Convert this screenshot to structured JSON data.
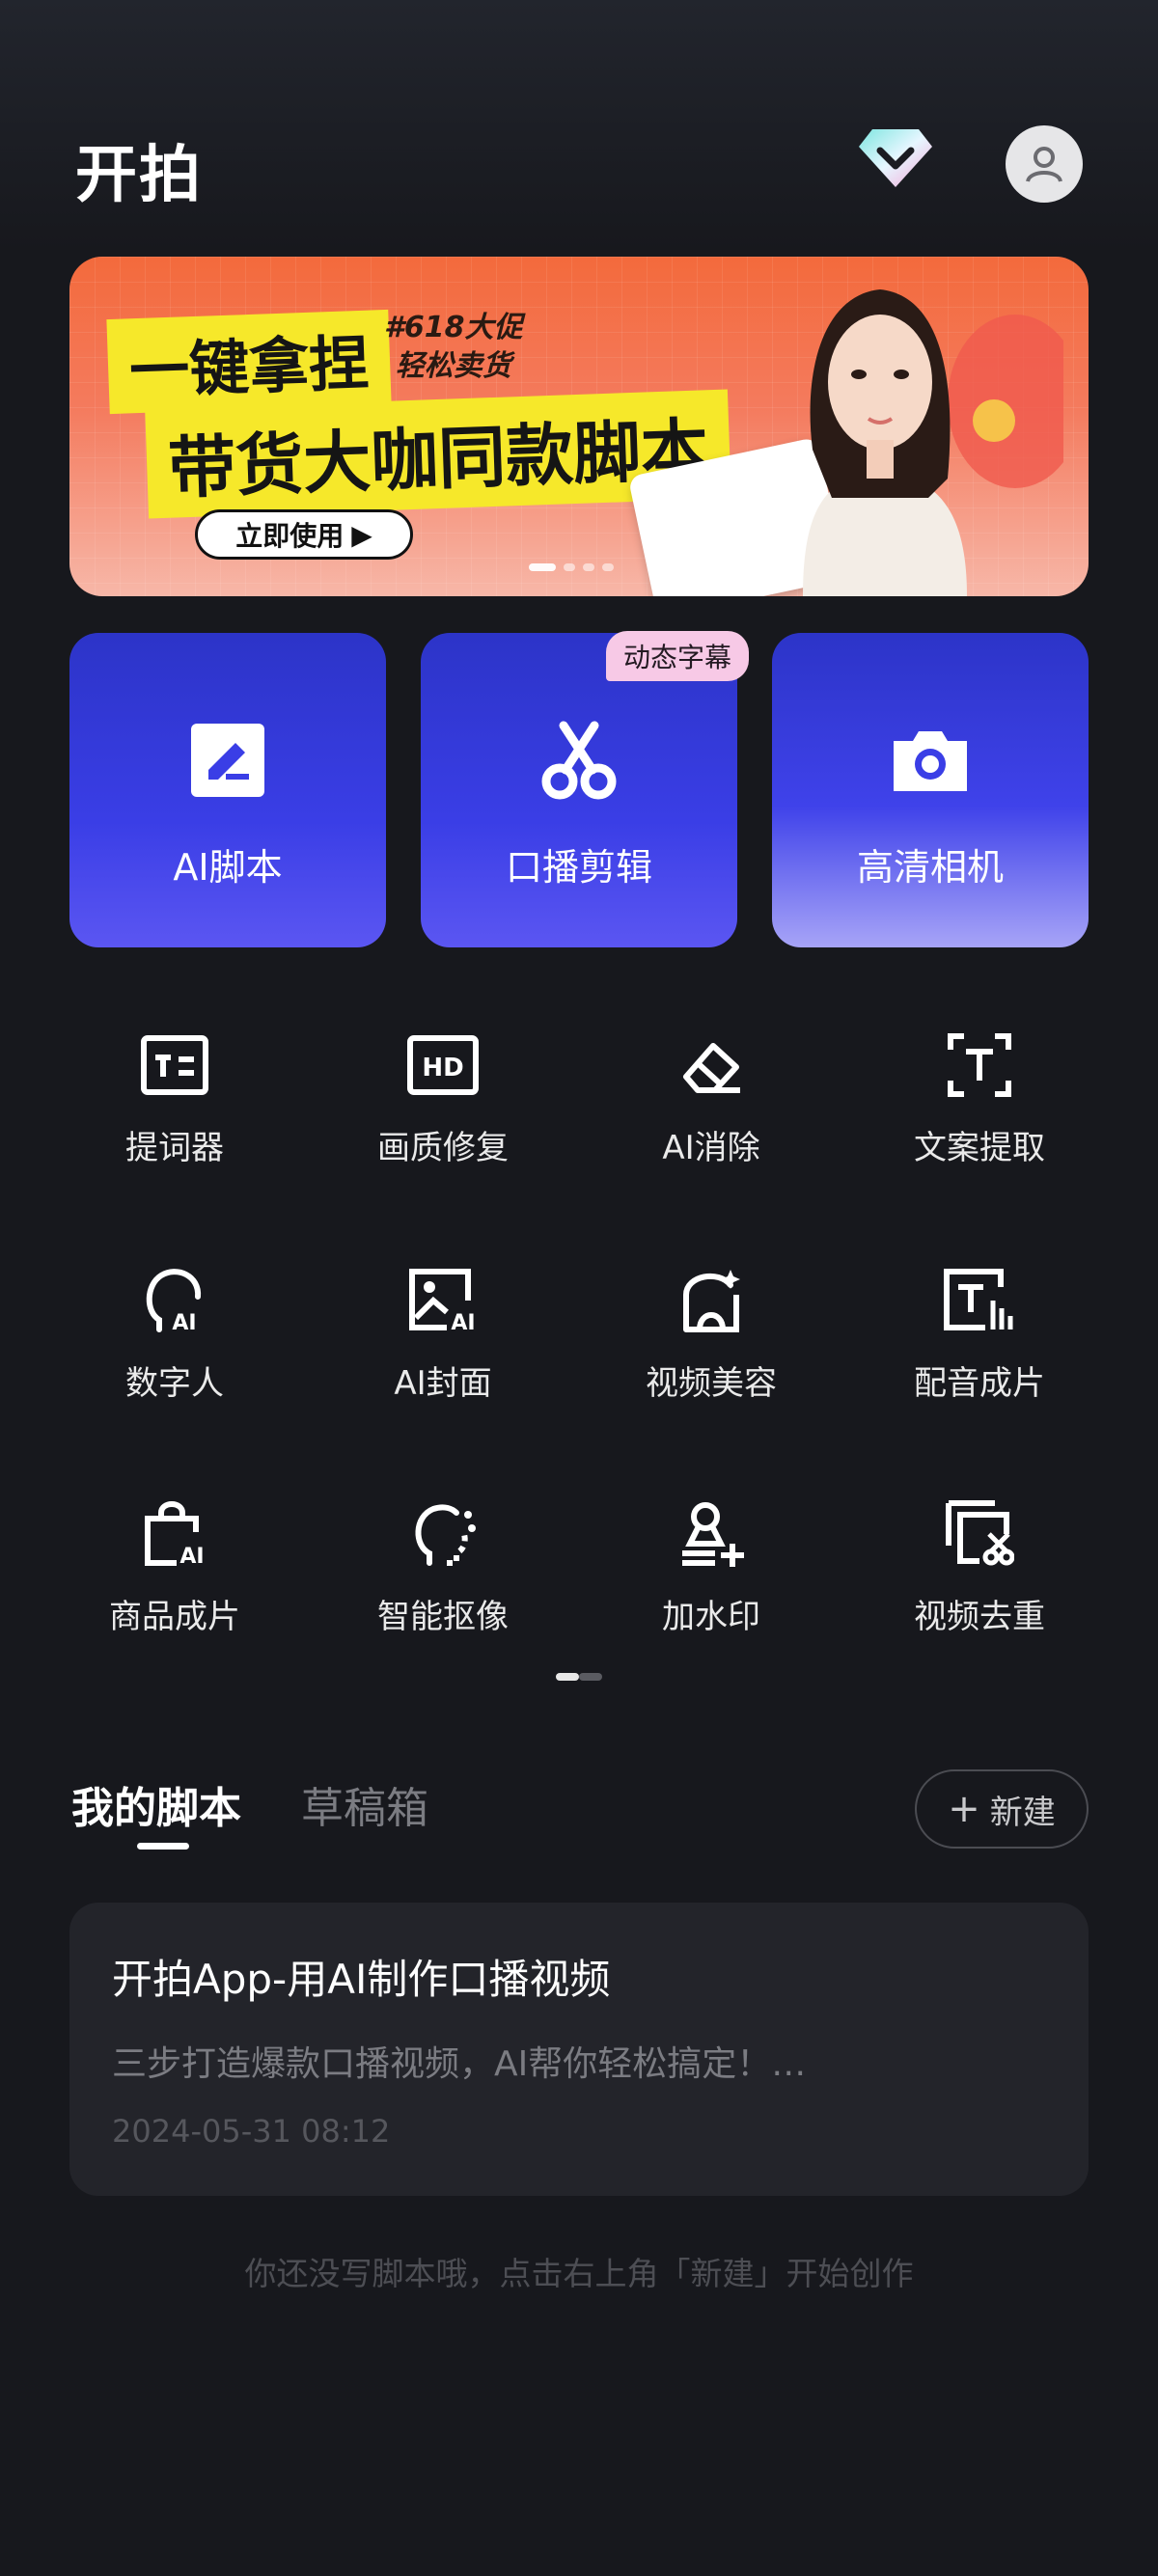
{
  "app": {
    "title": "开拍"
  },
  "banner": {
    "line1": "一键拿捏",
    "line2": "带货大咖同款脚本",
    "tag_line1": "#618大促",
    "tag_line2": "轻松卖货",
    "cta": "立即使用"
  },
  "features": [
    {
      "label": "AI脚本",
      "icon": "edit-icon"
    },
    {
      "label": "口播剪辑",
      "icon": "scissors-icon",
      "badge": "动态字幕"
    },
    {
      "label": "高清相机",
      "icon": "camera-icon"
    }
  ],
  "tools": [
    {
      "label": "提词器",
      "icon": "teleprompter-icon"
    },
    {
      "label": "画质修复",
      "icon": "hd-icon"
    },
    {
      "label": "AI消除",
      "icon": "eraser-icon"
    },
    {
      "label": "文案提取",
      "icon": "text-extract-icon"
    },
    {
      "label": "数字人",
      "icon": "digital-human-icon"
    },
    {
      "label": "AI封面",
      "icon": "ai-cover-icon"
    },
    {
      "label": "视频美容",
      "icon": "video-beauty-icon"
    },
    {
      "label": "配音成片",
      "icon": "voiceover-icon"
    },
    {
      "label": "商品成片",
      "icon": "product-video-icon"
    },
    {
      "label": "智能抠像",
      "icon": "smart-matting-icon"
    },
    {
      "label": "加水印",
      "icon": "watermark-icon"
    },
    {
      "label": "视频去重",
      "icon": "dedupe-icon"
    }
  ],
  "tabs": [
    {
      "label": "我的脚本",
      "active": true
    },
    {
      "label": "草稿箱",
      "active": false
    }
  ],
  "new_button": "新建",
  "script": {
    "title": "开拍App-用AI制作口播视频",
    "desc": "三步打造爆款口播视频，AI帮你轻松搞定！…",
    "time": "2024-05-31 08:12"
  },
  "empty_hint": "你还没写脚本哦，点击右上角「新建」开始创作",
  "colors": {
    "background": "#17181d",
    "card_blue": "#3a3ee6",
    "banner_yellow": "#f6e82a",
    "badge_pink": "#f7c9e6"
  }
}
